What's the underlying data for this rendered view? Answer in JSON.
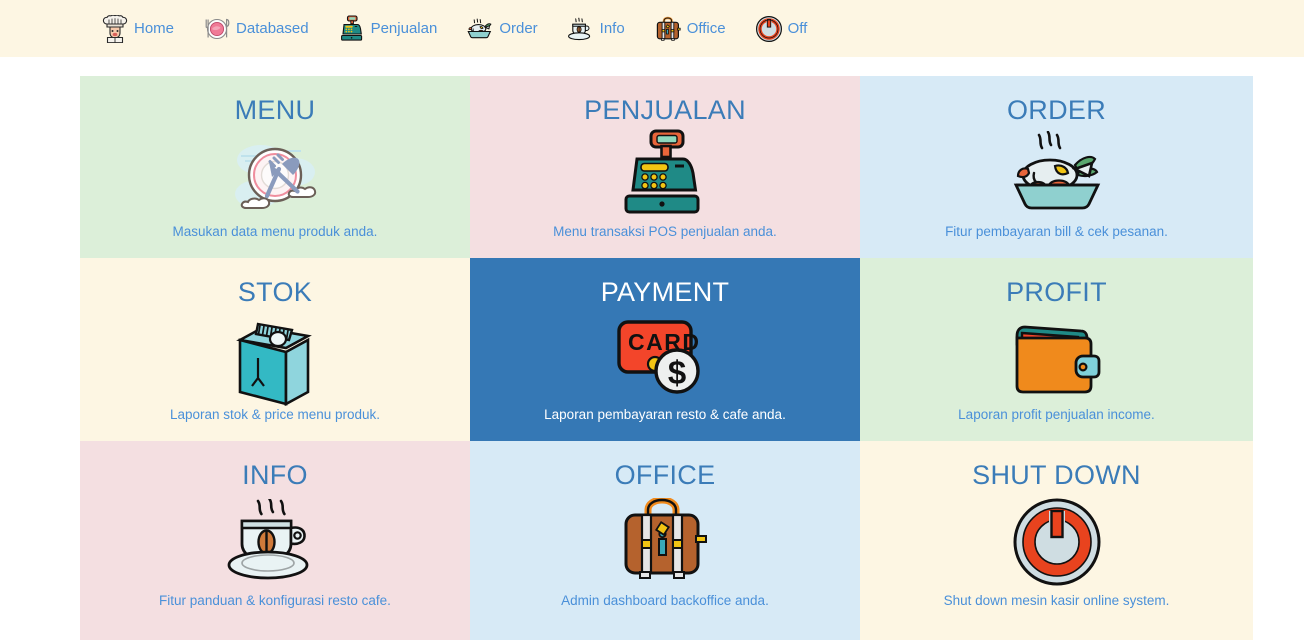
{
  "nav": {
    "background": "#fdf6e3",
    "link_color": "#4a90d9",
    "items": [
      {
        "label": "Home",
        "icon": "chef-hat-icon"
      },
      {
        "label": "Databased",
        "icon": "plate-cutlery-icon"
      },
      {
        "label": "Penjualan",
        "icon": "cash-register-icon"
      },
      {
        "label": "Order",
        "icon": "fish-plate-icon"
      },
      {
        "label": "Info",
        "icon": "coffee-cup-icon"
      },
      {
        "label": "Office",
        "icon": "briefcase-icon"
      },
      {
        "label": "Off",
        "icon": "power-icon"
      }
    ]
  },
  "grid": {
    "title_color": "#3b7cb8",
    "desc_color": "#4a90d9",
    "active_bg": "#3578b5",
    "active_text": "#ffffff",
    "tiles": [
      {
        "title": "MENU",
        "desc": "Masukan data menu produk anda.",
        "bg": "#dcefd9",
        "icon": "plate-fork-clouds-icon",
        "active": false
      },
      {
        "title": "PENJUALAN",
        "desc": "Menu transaksi POS penjualan anda.",
        "bg": "#f4dfe1",
        "icon": "cash-register-icon",
        "active": false
      },
      {
        "title": "ORDER",
        "desc": "Fitur pembayaran bill & cek pesanan.",
        "bg": "#d7eaf6",
        "icon": "fish-plate-icon",
        "active": false
      },
      {
        "title": "STOK",
        "desc": "Laporan stok & price menu produk.",
        "bg": "#fdf6e3",
        "icon": "milk-carton-icon",
        "active": false
      },
      {
        "title": "PAYMENT",
        "desc": "Laporan pembayaran resto & cafe anda.",
        "bg": "#3578b5",
        "icon": "card-coin-icon",
        "active": true
      },
      {
        "title": "PROFIT",
        "desc": "Laporan profit penjualan income.",
        "bg": "#dcefd9",
        "icon": "wallet-icon",
        "active": false
      },
      {
        "title": "INFO",
        "desc": "Fitur panduan & konfigurasi resto cafe.",
        "bg": "#f4dfe1",
        "icon": "coffee-cup-icon",
        "active": false
      },
      {
        "title": "OFFICE",
        "desc": "Admin dashboard backoffice anda.",
        "bg": "#d7eaf6",
        "icon": "briefcase-icon",
        "active": false
      },
      {
        "title": "SHUT DOWN",
        "desc": "Shut down mesin kasir online system.",
        "bg": "#fdf6e3",
        "icon": "power-icon",
        "active": false
      }
    ]
  }
}
